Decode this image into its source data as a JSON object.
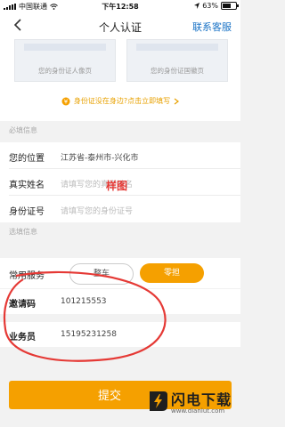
{
  "status_bar": {
    "carrier": "中国联通",
    "time": "下午12:58",
    "battery": "63%",
    "battery_level": 0.63
  },
  "nav": {
    "title": "个人认证",
    "right_action": "联系客服"
  },
  "upload": {
    "front_label": "您的身份证人像页",
    "back_label": "您的身份证国徽页"
  },
  "tip": {
    "text": "身份证没在身边?点击立即填写"
  },
  "required_section": {
    "title": "必填信息"
  },
  "fields": {
    "location": {
      "label": "您的位置",
      "value": "江苏省-泰州市-兴化市"
    },
    "name": {
      "label": "真实姓名",
      "placeholder": "请填写您的真实姓名"
    },
    "id": {
      "label": "身份证号",
      "placeholder": "请填写您的身份证号"
    }
  },
  "sample_watermark": "样图",
  "optional_section": {
    "title": "选填信息"
  },
  "service": {
    "label": "常用服务",
    "options": [
      "整车",
      "零担"
    ],
    "selected": "零担"
  },
  "invite": {
    "label": "邀请码",
    "value": "101215553"
  },
  "salesman": {
    "label": "业务员",
    "value": "15195231258"
  },
  "submit": {
    "label": "提交"
  },
  "logo": {
    "brand": "闪电下载",
    "url": "www.dianlut.com"
  },
  "colors": {
    "accent": "#f5a000",
    "link": "#1a73c6",
    "annotation": "#e53935"
  }
}
